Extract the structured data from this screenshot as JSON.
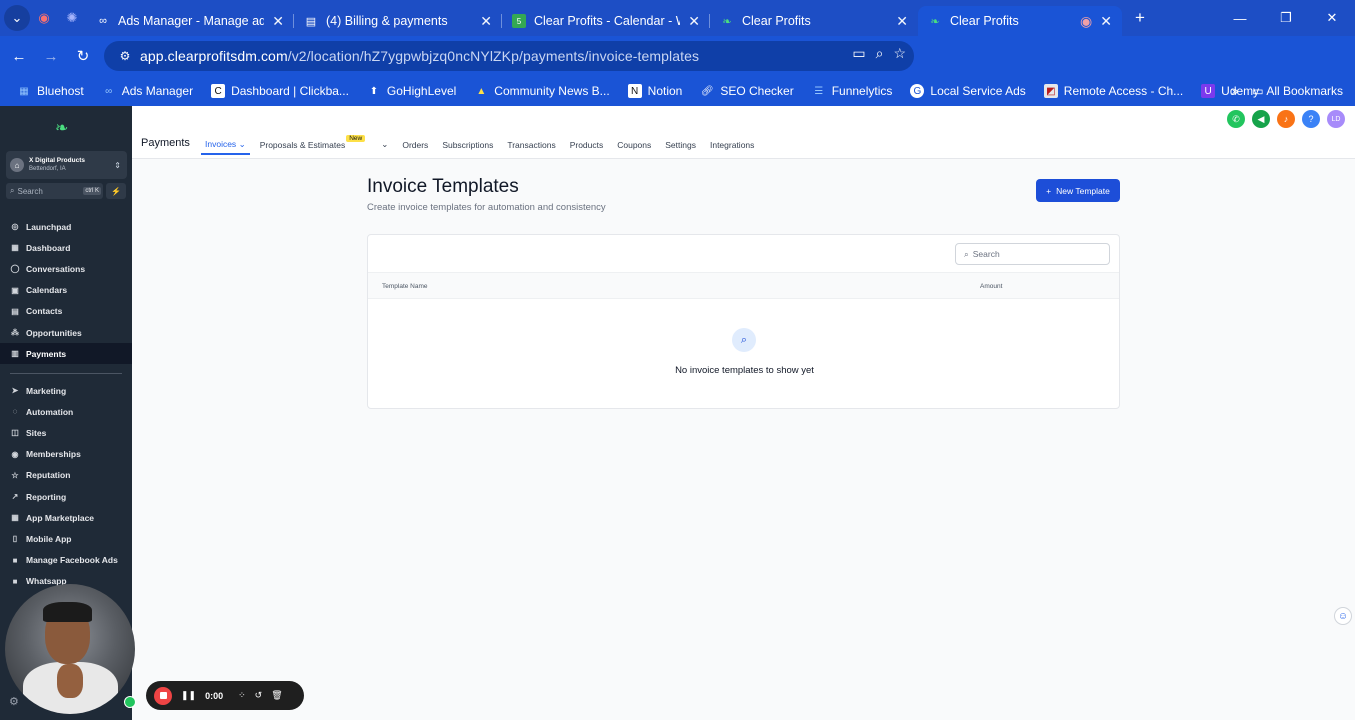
{
  "browser": {
    "tabs": [
      {
        "title": "Ads Manager - Manage ads - A",
        "icon": "meta-icon"
      },
      {
        "title": "(4) Billing & payments",
        "icon": "billing-icon"
      },
      {
        "title": "Clear Profits - Calendar - Week",
        "icon": "calendar-icon"
      },
      {
        "title": "Clear Profits",
        "icon": "leaf-icon"
      },
      {
        "title": "Clear Profits",
        "icon": "leaf-icon"
      }
    ],
    "url_host": "app.clearprofitsdm.com",
    "url_path": "/v2/location/hZ7ygpwbjzq0ncNYlZKp/payments/invoice-templates",
    "bookmarks": [
      "Bluehost",
      "Ads Manager",
      "Dashboard | Clickba...",
      "GoHighLevel",
      "Community News B...",
      "Notion",
      "SEO Checker",
      "Funnelytics",
      "Local Service Ads",
      "Remote Access - Ch...",
      "Udemy"
    ],
    "all_bookmarks": "All Bookmarks",
    "overflow": "»"
  },
  "sidebar": {
    "account_name": "X Digital Products",
    "account_location": "Bettendorf, IA",
    "search_placeholder": "Search",
    "search_shortcut": "ctrl K",
    "menu": [
      {
        "label": "Launchpad",
        "icon": "rocket-icon"
      },
      {
        "label": "Dashboard",
        "icon": "grid-icon"
      },
      {
        "label": "Conversations",
        "icon": "chat-icon"
      },
      {
        "label": "Calendars",
        "icon": "calendar-icon"
      },
      {
        "label": "Contacts",
        "icon": "contacts-icon"
      },
      {
        "label": "Opportunities",
        "icon": "funnel-icon"
      },
      {
        "label": "Payments",
        "icon": "payments-icon",
        "active": true
      }
    ],
    "menu2": [
      {
        "label": "Marketing",
        "icon": "send-icon"
      },
      {
        "label": "Automation",
        "icon": "automation-icon"
      },
      {
        "label": "Sites",
        "icon": "sites-icon"
      },
      {
        "label": "Memberships",
        "icon": "memberships-icon"
      },
      {
        "label": "Reputation",
        "icon": "star-icon"
      },
      {
        "label": "Reporting",
        "icon": "chart-icon"
      },
      {
        "label": "App Marketplace",
        "icon": "apps-icon"
      },
      {
        "label": "Mobile App",
        "icon": "phone-icon"
      },
      {
        "label": "Manage Facebook Ads",
        "icon": "facebook-icon"
      },
      {
        "label": "Whatsapp",
        "icon": "whatsapp-icon"
      }
    ]
  },
  "topnav": {
    "title": "Payments",
    "tabs": [
      "Invoices",
      "Proposals & Estimates",
      "Orders",
      "Subscriptions",
      "Transactions",
      "Products",
      "Coupons",
      "Settings",
      "Integrations"
    ],
    "new_badge": "New",
    "user_initials": "LD"
  },
  "content": {
    "heading": "Invoice Templates",
    "subheading": "Create invoice templates for automation and consistency",
    "new_button": "New Template",
    "search_placeholder": "Search",
    "col_name": "Template Name",
    "col_amount": "Amount",
    "empty_text": "No invoice templates to show yet"
  },
  "recorder": {
    "time": "0:00"
  },
  "colors": {
    "browser_blue": "#1a54d6",
    "sidebar_bg": "#1f2a37",
    "accent": "#1d4ed8"
  }
}
